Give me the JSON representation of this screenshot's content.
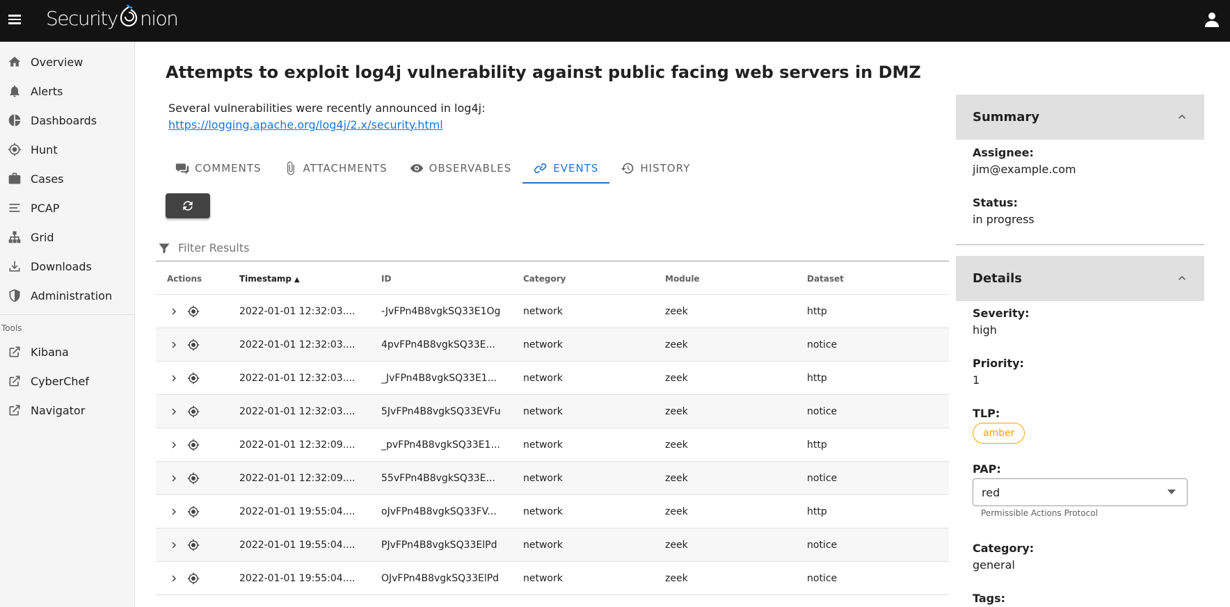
{
  "brand": {
    "name_left": "Security",
    "name_right": "nion"
  },
  "sidebar": {
    "items": [
      {
        "label": "Overview",
        "icon": "home-icon"
      },
      {
        "label": "Alerts",
        "icon": "bell-icon"
      },
      {
        "label": "Dashboards",
        "icon": "pie-chart-icon"
      },
      {
        "label": "Hunt",
        "icon": "crosshairs-icon"
      },
      {
        "label": "Cases",
        "icon": "briefcase-icon"
      },
      {
        "label": "PCAP",
        "icon": "lines-icon"
      },
      {
        "label": "Grid",
        "icon": "sitemap-icon"
      },
      {
        "label": "Downloads",
        "icon": "download-icon"
      },
      {
        "label": "Administration",
        "icon": "shield-icon"
      }
    ],
    "tools_label": "Tools",
    "tools": [
      {
        "label": "Kibana",
        "icon": "external-link-icon"
      },
      {
        "label": "CyberChef",
        "icon": "external-link-icon"
      },
      {
        "label": "Navigator",
        "icon": "external-link-icon"
      }
    ]
  },
  "case": {
    "title": "Attempts to exploit log4j vulnerability against public facing web servers in DMZ",
    "description": "Several vulnerabilities were recently announced in log4j:",
    "link": "https://logging.apache.org/log4j/2.x/security.html"
  },
  "tabs": [
    {
      "label": "COMMENTS",
      "icon": "comments-icon",
      "active": false
    },
    {
      "label": "ATTACHMENTS",
      "icon": "paperclip-icon",
      "active": false
    },
    {
      "label": "OBSERVABLES",
      "icon": "eye-icon",
      "active": false
    },
    {
      "label": "EVENTS",
      "icon": "link-icon",
      "active": true
    },
    {
      "label": "HISTORY",
      "icon": "history-icon",
      "active": false
    }
  ],
  "filter": {
    "placeholder": "Filter Results"
  },
  "table": {
    "headers": {
      "actions": "Actions",
      "timestamp": "Timestamp",
      "id": "ID",
      "category": "Category",
      "module": "Module",
      "dataset": "Dataset"
    },
    "rows": [
      {
        "timestamp": "2022-01-01 12:32:03....",
        "id": "-JvFPn4B8vgkSQ33E1Og",
        "category": "network",
        "module": "zeek",
        "dataset": "http"
      },
      {
        "timestamp": "2022-01-01 12:32:03....",
        "id": "4pvFPn4B8vgkSQ33E...",
        "category": "network",
        "module": "zeek",
        "dataset": "notice"
      },
      {
        "timestamp": "2022-01-01 12:32:03....",
        "id": "_JvFPn4B8vgkSQ33E1...",
        "category": "network",
        "module": "zeek",
        "dataset": "http"
      },
      {
        "timestamp": "2022-01-01 12:32:03....",
        "id": "5JvFPn4B8vgkSQ33EVFu",
        "category": "network",
        "module": "zeek",
        "dataset": "notice"
      },
      {
        "timestamp": "2022-01-01 12:32:09....",
        "id": "_pvFPn4B8vgkSQ33E1...",
        "category": "network",
        "module": "zeek",
        "dataset": "http"
      },
      {
        "timestamp": "2022-01-01 12:32:09....",
        "id": "55vFPn4B8vgkSQ33E...",
        "category": "network",
        "module": "zeek",
        "dataset": "notice"
      },
      {
        "timestamp": "2022-01-01 19:55:04....",
        "id": "oJvFPn4B8vgkSQ33FV...",
        "category": "network",
        "module": "zeek",
        "dataset": "http"
      },
      {
        "timestamp": "2022-01-01 19:55:04....",
        "id": "PJvFPn4B8vgkSQ33ElPd",
        "category": "network",
        "module": "zeek",
        "dataset": "notice"
      },
      {
        "timestamp": "2022-01-01 19:55:04....",
        "id": "OJvFPn4B8vgkSQ33ElPd",
        "category": "network",
        "module": "zeek",
        "dataset": "notice"
      }
    ]
  },
  "summary": {
    "title": "Summary",
    "assignee_label": "Assignee:",
    "assignee": "jim@example.com",
    "status_label": "Status:",
    "status": "in progress"
  },
  "details": {
    "title": "Details",
    "severity_label": "Severity:",
    "severity": "high",
    "priority_label": "Priority:",
    "priority": "1",
    "tlp_label": "TLP:",
    "tlp": "amber",
    "pap_label": "PAP:",
    "pap": "red",
    "pap_hint": "Permissible Actions Protocol",
    "category_label": "Category:",
    "category": "general",
    "tags_label": "Tags:"
  },
  "colors": {
    "accent": "#1976d2",
    "topbar": "#131313",
    "tlp_amber": "#ffa000"
  }
}
